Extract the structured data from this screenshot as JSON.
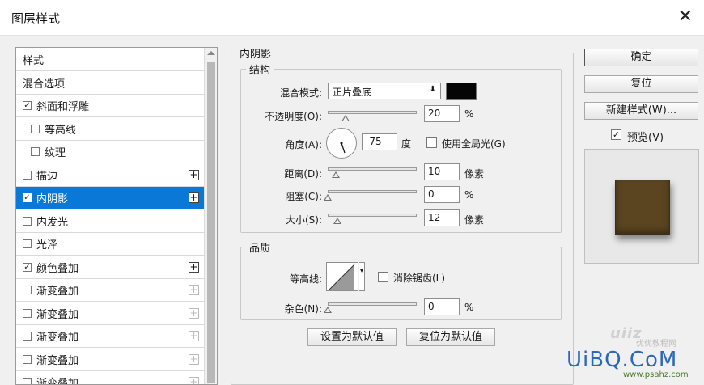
{
  "window": {
    "title": "图层样式",
    "close_icon": "close-icon"
  },
  "style_list": {
    "items": [
      {
        "label": "样式",
        "checkbox": false,
        "checked": false,
        "indent": 0,
        "plus": "none",
        "selected": false
      },
      {
        "label": "混合选项",
        "checkbox": false,
        "checked": false,
        "indent": 0,
        "plus": "none",
        "selected": false
      },
      {
        "label": "斜面和浮雕",
        "checkbox": true,
        "checked": true,
        "indent": 0,
        "plus": "none",
        "selected": false
      },
      {
        "label": "等高线",
        "checkbox": true,
        "checked": false,
        "indent": 1,
        "plus": "none",
        "selected": false
      },
      {
        "label": "纹理",
        "checkbox": true,
        "checked": false,
        "indent": 1,
        "plus": "none",
        "selected": false
      },
      {
        "label": "描边",
        "checkbox": true,
        "checked": false,
        "indent": 0,
        "plus": "active",
        "selected": false
      },
      {
        "label": "内阴影",
        "checkbox": true,
        "checked": true,
        "indent": 0,
        "plus": "active",
        "selected": true
      },
      {
        "label": "内发光",
        "checkbox": true,
        "checked": false,
        "indent": 0,
        "plus": "none",
        "selected": false
      },
      {
        "label": "光泽",
        "checkbox": true,
        "checked": false,
        "indent": 0,
        "plus": "none",
        "selected": false
      },
      {
        "label": "颜色叠加",
        "checkbox": true,
        "checked": true,
        "indent": 0,
        "plus": "active",
        "selected": false
      },
      {
        "label": "渐变叠加",
        "checkbox": true,
        "checked": false,
        "indent": 0,
        "plus": "dim",
        "selected": false
      },
      {
        "label": "渐变叠加",
        "checkbox": true,
        "checked": false,
        "indent": 0,
        "plus": "dim",
        "selected": false
      },
      {
        "label": "渐变叠加",
        "checkbox": true,
        "checked": false,
        "indent": 0,
        "plus": "dim",
        "selected": false
      },
      {
        "label": "渐变叠加",
        "checkbox": true,
        "checked": false,
        "indent": 0,
        "plus": "dim",
        "selected": false
      },
      {
        "label": "渐变叠加",
        "checkbox": true,
        "checked": false,
        "indent": 0,
        "plus": "dim",
        "selected": false
      }
    ]
  },
  "panel": {
    "title": "内阴影",
    "structure": {
      "legend": "结构",
      "blend_mode_label": "混合模式:",
      "blend_mode_value": "正片叠底",
      "color": "#050505",
      "opacity_label": "不透明度(O):",
      "opacity_value": "20",
      "opacity_unit": "%",
      "opacity_level": 0.2,
      "angle_label": "角度(A):",
      "angle_value": "-75",
      "angle_unit": "度",
      "global_light_label": "使用全局光(G)",
      "global_light_checked": false,
      "distance_label": "距离(D):",
      "distance_value": "10",
      "distance_unit": "像素",
      "choke_label": "阻塞(C):",
      "choke_value": "0",
      "choke_unit": "%",
      "size_label": "大小(S):",
      "size_value": "12",
      "size_unit": "像素"
    },
    "quality": {
      "legend": "品质",
      "contour_label": "等高线:",
      "antialias_label": "消除锯齿(L)",
      "antialias_checked": false,
      "noise_label": "杂色(N):",
      "noise_value": "0",
      "noise_unit": "%"
    },
    "buttons": {
      "make_default": "设置为默认值",
      "reset_default": "复位为默认值"
    }
  },
  "actions": {
    "ok": "确定",
    "reset": "复位",
    "new_style": "新建样式(W)...",
    "preview_label": "预览(V)",
    "preview_checked": true,
    "preview_swatch_color": "#5a4520"
  },
  "watermark": {
    "brand": "UiBQ.CoM",
    "subtitle": "优优教程网",
    "site": "www.psahz.com"
  }
}
